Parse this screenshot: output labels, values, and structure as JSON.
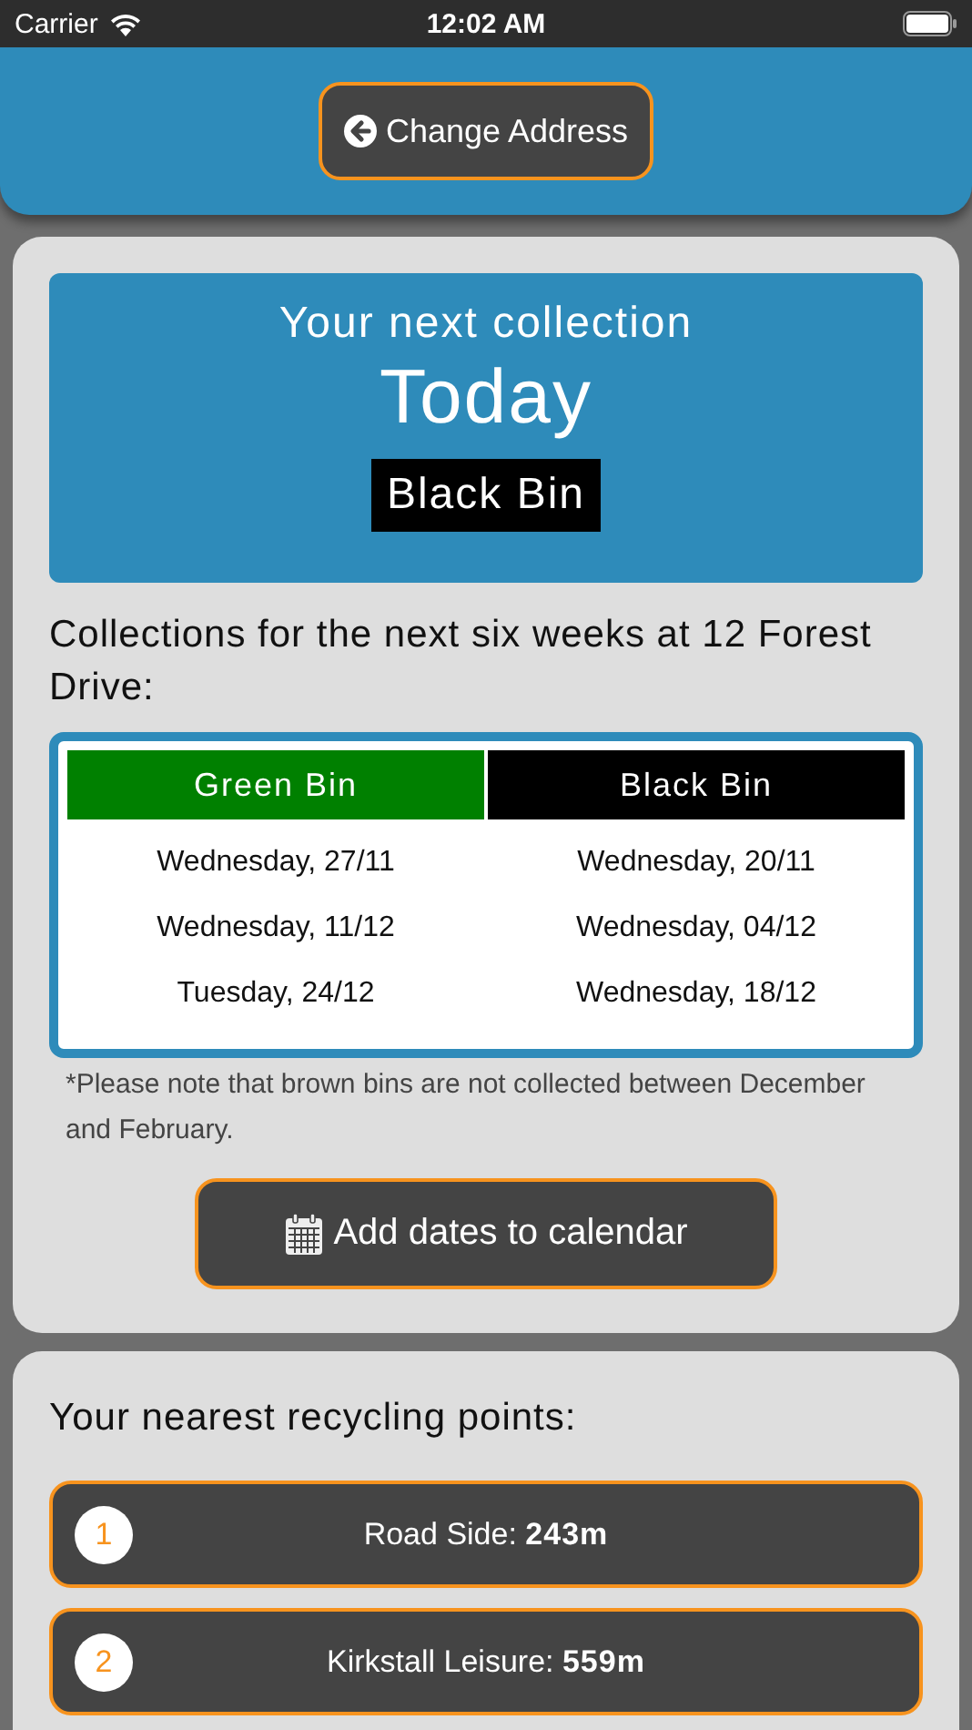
{
  "status_bar": {
    "carrier": "Carrier",
    "time": "12:02 AM"
  },
  "header": {
    "button": "Change Address"
  },
  "next_collection": {
    "title": "Your next collection",
    "when": "Today",
    "bin": "Black Bin"
  },
  "schedule": {
    "heading": "Collections for the next six weeks at 12 Forest Drive:",
    "columns": [
      {
        "label": "Green Bin",
        "color": "#008000",
        "dates": [
          "Wednesday, 27/11",
          "Wednesday, 11/12",
          "Tuesday, 24/12"
        ]
      },
      {
        "label": "Black Bin",
        "color": "#000000",
        "dates": [
          "Wednesday, 20/11",
          "Wednesday, 04/12",
          "Wednesday, 18/12"
        ]
      }
    ],
    "note": "*Please note that brown bins are not collected between December and February.",
    "button": "Add dates to calendar"
  },
  "recycling": {
    "heading": "Your nearest recycling points:",
    "points": [
      {
        "number": "1",
        "name": "Road Side:",
        "distance": "243m"
      },
      {
        "number": "2",
        "name": "Kirkstall Leisure:",
        "distance": "559m"
      }
    ]
  }
}
